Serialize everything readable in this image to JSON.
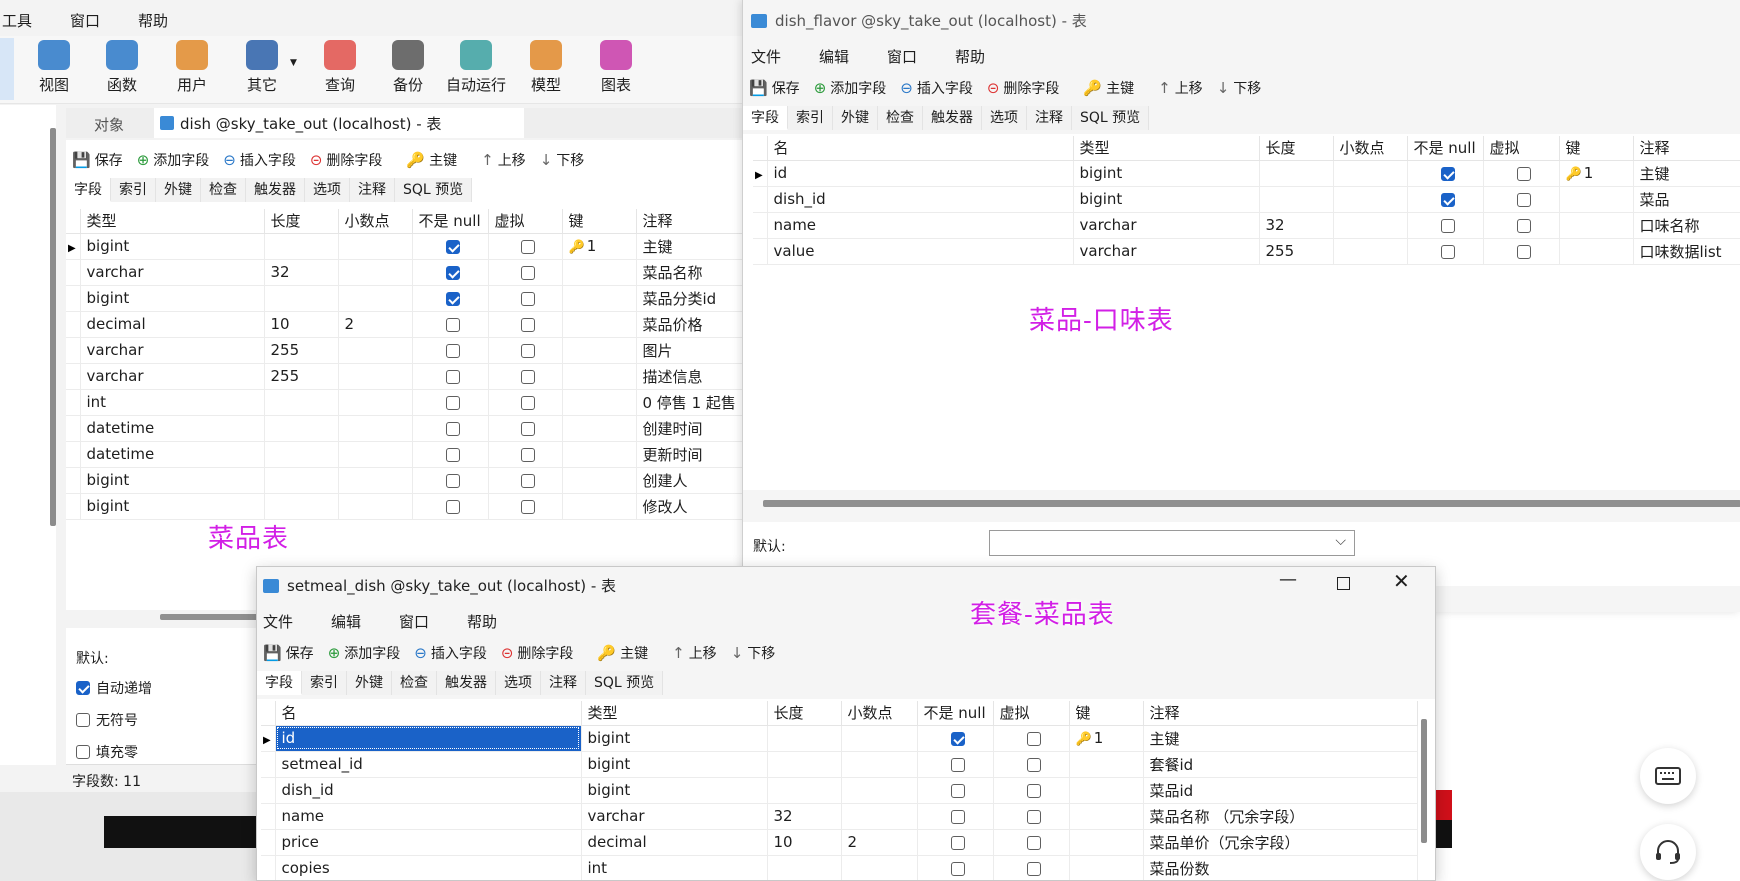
{
  "main": {
    "menus": [
      "工具",
      "窗口",
      "帮助"
    ],
    "ribbon": [
      {
        "label": "视图",
        "icon": "view-icon"
      },
      {
        "label": "函数",
        "icon": "function-icon"
      },
      {
        "label": "用户",
        "icon": "user-icon"
      },
      {
        "label": "其它",
        "icon": "tools-icon"
      },
      {
        "label": "查询",
        "icon": "query-icon"
      },
      {
        "label": "备份",
        "icon": "backup-icon"
      },
      {
        "label": "自动运行",
        "icon": "robot-icon"
      },
      {
        "label": "模型",
        "icon": "model-icon"
      },
      {
        "label": "图表",
        "icon": "chart-icon"
      }
    ],
    "doc_tabs": {
      "objects": "对象",
      "active": "dish @sky_take_out (localhost) - 表"
    },
    "toolbar": [
      "保存",
      "添加字段",
      "插入字段",
      "删除字段",
      "主键",
      "上移",
      "下移"
    ],
    "tabs": [
      "字段",
      "索引",
      "外键",
      "检查",
      "触发器",
      "选项",
      "注释",
      "SQL 预览"
    ],
    "columns": [
      "类型",
      "长度",
      "小数点",
      "不是 null",
      "虚拟",
      "键",
      "注释"
    ],
    "rows": [
      {
        "type": "bigint",
        "len": "",
        "dec": "",
        "notnull": true,
        "virtual": false,
        "key": "1",
        "comment": "主键",
        "current": true
      },
      {
        "type": "varchar",
        "len": "32",
        "dec": "",
        "notnull": true,
        "virtual": false,
        "key": "",
        "comment": "菜品名称"
      },
      {
        "type": "bigint",
        "len": "",
        "dec": "",
        "notnull": true,
        "virtual": false,
        "key": "",
        "comment": "菜品分类id"
      },
      {
        "type": "decimal",
        "len": "10",
        "dec": "2",
        "notnull": false,
        "virtual": false,
        "key": "",
        "comment": "菜品价格"
      },
      {
        "type": "varchar",
        "len": "255",
        "dec": "",
        "notnull": false,
        "virtual": false,
        "key": "",
        "comment": "图片"
      },
      {
        "type": "varchar",
        "len": "255",
        "dec": "",
        "notnull": false,
        "virtual": false,
        "key": "",
        "comment": "描述信息"
      },
      {
        "type": "int",
        "len": "",
        "dec": "",
        "notnull": false,
        "virtual": false,
        "key": "",
        "comment": "0 停售 1 起售"
      },
      {
        "type": "datetime",
        "len": "",
        "dec": "",
        "notnull": false,
        "virtual": false,
        "key": "",
        "comment": "创建时间"
      },
      {
        "type": "datetime",
        "len": "",
        "dec": "",
        "notnull": false,
        "virtual": false,
        "key": "",
        "comment": "更新时间"
      },
      {
        "type": "bigint",
        "len": "",
        "dec": "",
        "notnull": false,
        "virtual": false,
        "key": "",
        "comment": "创建人"
      },
      {
        "type": "bigint",
        "len": "",
        "dec": "",
        "notnull": false,
        "virtual": false,
        "key": "",
        "comment": "修改人"
      }
    ],
    "overlay_label": "菜品表",
    "defaults_label": "默认:",
    "options": [
      {
        "label": "自动递增",
        "checked": true
      },
      {
        "label": "无符号",
        "checked": false
      },
      {
        "label": "填充零",
        "checked": false
      }
    ],
    "status": "字段数: 11"
  },
  "flavor": {
    "title": "dish_flavor @sky_take_out (localhost) - 表",
    "menus": [
      "文件",
      "编辑",
      "窗口",
      "帮助"
    ],
    "toolbar": [
      "保存",
      "添加字段",
      "插入字段",
      "删除字段",
      "主键",
      "上移",
      "下移"
    ],
    "tabs": [
      "字段",
      "索引",
      "外键",
      "检查",
      "触发器",
      "选项",
      "注释",
      "SQL 预览"
    ],
    "columns": [
      "名",
      "类型",
      "长度",
      "小数点",
      "不是 null",
      "虚拟",
      "键",
      "注释"
    ],
    "rows": [
      {
        "name": "id",
        "type": "bigint",
        "len": "",
        "dec": "",
        "notnull": true,
        "virtual": false,
        "key": "1",
        "comment": "主键",
        "current": true
      },
      {
        "name": "dish_id",
        "type": "bigint",
        "len": "",
        "dec": "",
        "notnull": true,
        "virtual": false,
        "key": "",
        "comment": "菜品"
      },
      {
        "name": "name",
        "type": "varchar",
        "len": "32",
        "dec": "",
        "notnull": false,
        "virtual": false,
        "key": "",
        "comment": "口味名称"
      },
      {
        "name": "value",
        "type": "varchar",
        "len": "255",
        "dec": "",
        "notnull": false,
        "virtual": false,
        "key": "",
        "comment": "口味数据list"
      }
    ],
    "overlay_label": "菜品-口味表",
    "defaults_label": "默认:"
  },
  "setmeal": {
    "title": "setmeal_dish @sky_take_out (localhost) - 表",
    "overlay_label": "套餐-菜品表",
    "menus": [
      "文件",
      "编辑",
      "窗口",
      "帮助"
    ],
    "toolbar": [
      "保存",
      "添加字段",
      "插入字段",
      "删除字段",
      "主键",
      "上移",
      "下移"
    ],
    "tabs": [
      "字段",
      "索引",
      "外键",
      "检查",
      "触发器",
      "选项",
      "注释",
      "SQL 预览"
    ],
    "columns": [
      "名",
      "类型",
      "长度",
      "小数点",
      "不是 null",
      "虚拟",
      "键",
      "注释"
    ],
    "rows": [
      {
        "name": "id",
        "type": "bigint",
        "len": "",
        "dec": "",
        "notnull": true,
        "virtual": false,
        "key": "1",
        "comment": "主键",
        "current": true,
        "selected": true
      },
      {
        "name": "setmeal_id",
        "type": "bigint",
        "len": "",
        "dec": "",
        "notnull": false,
        "virtual": false,
        "key": "",
        "comment": "套餐id"
      },
      {
        "name": "dish_id",
        "type": "bigint",
        "len": "",
        "dec": "",
        "notnull": false,
        "virtual": false,
        "key": "",
        "comment": "菜品id"
      },
      {
        "name": "name",
        "type": "varchar",
        "len": "32",
        "dec": "",
        "notnull": false,
        "virtual": false,
        "key": "",
        "comment": "菜品名称 （冗余字段）"
      },
      {
        "name": "price",
        "type": "decimal",
        "len": "10",
        "dec": "2",
        "notnull": false,
        "virtual": false,
        "key": "",
        "comment": "菜品单价（冗余字段）"
      },
      {
        "name": "copies",
        "type": "int",
        "len": "",
        "dec": "",
        "notnull": false,
        "virtual": false,
        "key": "",
        "comment": "菜品份数"
      }
    ]
  },
  "colors": {
    "accent": "#1a62c8",
    "label": "#d21fe6"
  }
}
